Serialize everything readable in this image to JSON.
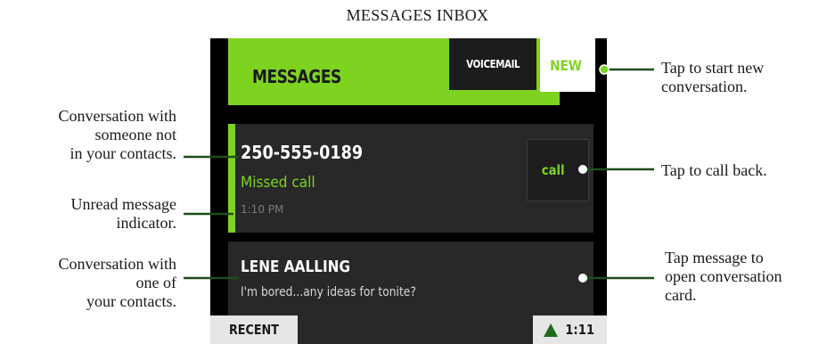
{
  "figure_title": "MESSAGES INBOX",
  "app": {
    "header_title": "MESSAGES",
    "voicemail_label": "VOICEMAIL",
    "new_label": "NEW"
  },
  "conversations": [
    {
      "title": "250-555-0189",
      "status": "Missed call",
      "time": "1:10 PM",
      "unread": true,
      "action_label": "call"
    },
    {
      "title": "LENE AALLING",
      "preview": "I'm bored...any ideas for tonite?",
      "unread": false
    }
  ],
  "footer": {
    "recent_label": "RECENT",
    "clock": "1:11"
  },
  "annotations": {
    "unknown_contact": "Conversation with\nsomeone not\nin your contacts.",
    "unread_indicator": "Unread message\nindicator.",
    "known_contact": "Conversation with\none of\nyour contacts.",
    "new_conversation": "Tap to start new\nconversation.",
    "call_back": "Tap to call back.",
    "open_card": "Tap message to\nopen conversation\ncard."
  },
  "colors": {
    "accent_green": "#7ed321",
    "row_background": "#282828",
    "screen_background": "#000000",
    "callout_line": "#1e4d1e"
  },
  "icons": {
    "signal_icon": "triangle-up"
  }
}
